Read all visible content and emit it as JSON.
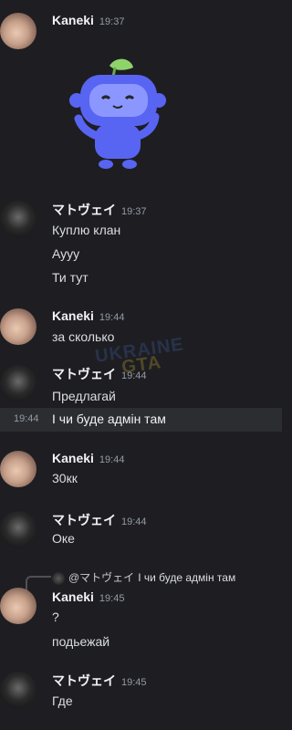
{
  "messages": [
    {
      "author": "Kaneki",
      "time": "19:37"
    },
    {
      "author": "マトヴェイ",
      "time": "19:37",
      "lines": [
        "Куплю клан",
        "Аууу",
        "Ти тут"
      ]
    },
    {
      "author": "Kaneki",
      "time": "19:44",
      "lines": [
        "за сколько"
      ]
    },
    {
      "author": "マトヴェイ",
      "time": "19:44",
      "lines": [
        "Предлагай"
      ]
    },
    {
      "highlight_time": "19:44",
      "highlight_text": "І чи буде адмін там"
    },
    {
      "author": "Kaneki",
      "time": "19:44",
      "lines": [
        "30кк"
      ]
    },
    {
      "author": "マトヴェイ",
      "time": "19:44",
      "lines": [
        "Оке"
      ]
    },
    {
      "reply_author": "@マトヴェイ",
      "reply_text": "І чи буде адмін там",
      "author": "Kaneki",
      "time": "19:45",
      "lines": [
        "?",
        "подьежай"
      ]
    },
    {
      "author": "マトヴェイ",
      "time": "19:45",
      "lines": [
        "Где"
      ]
    }
  ],
  "watermark": {
    "line1": "UKRAINE",
    "line2": "GTA"
  },
  "colors": {
    "background": "#1e1e22",
    "highlight": "#2b2d31",
    "sticker": "#5865f2"
  }
}
